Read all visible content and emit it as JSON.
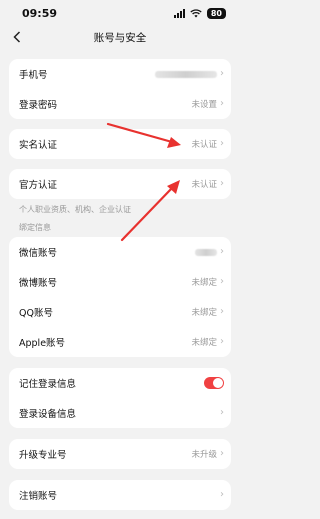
{
  "status": {
    "time": "09:59",
    "battery": "80"
  },
  "nav": {
    "title": "账号与安全"
  },
  "group1": {
    "phone_label": "手机号",
    "password_label": "登录密码",
    "password_value": "未设置"
  },
  "realname": {
    "label": "实名认证",
    "value": "未认证"
  },
  "official": {
    "label": "官方认证",
    "value": "未认证",
    "note": "个人职业资质、机构、企业认证"
  },
  "binding_header": "绑定信息",
  "bindings": {
    "wechat_label": "微信账号",
    "weibo_label": "微博账号",
    "weibo_value": "未绑定",
    "qq_label": "QQ账号",
    "qq_value": "未绑定",
    "apple_label": "Apple账号",
    "apple_value": "未绑定"
  },
  "login": {
    "remember_label": "记住登录信息",
    "remember_on": true,
    "devices_label": "登录设备信息"
  },
  "upgrade": {
    "label": "升级专业号",
    "value": "未升级"
  },
  "cancel": {
    "label": "注销账号"
  },
  "colors": {
    "accent": "#f04142",
    "arrow": "#e8322f"
  }
}
